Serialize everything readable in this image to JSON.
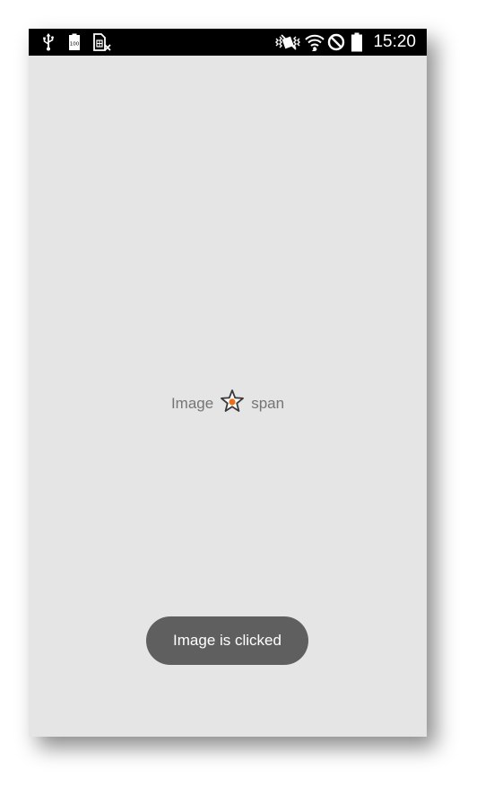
{
  "status_bar": {
    "time": "15:20",
    "left_icons": [
      "usb-icon",
      "battery-100-icon",
      "sim-card-missing-icon"
    ],
    "right_icons": [
      "vibrate-icon",
      "wifi-icon",
      "do-not-disturb-icon",
      "battery-icon"
    ],
    "battery_badge": "100"
  },
  "content": {
    "left_text": "Image",
    "right_text": "span",
    "star_icon": "star-icon",
    "star_fill_color": "#e8701a"
  },
  "toast": {
    "message": "Image is clicked"
  },
  "colors": {
    "background": "#e5e5e5",
    "status_bar": "#000000",
    "toast_bg": "#5f5f5f",
    "text": "#757575"
  }
}
